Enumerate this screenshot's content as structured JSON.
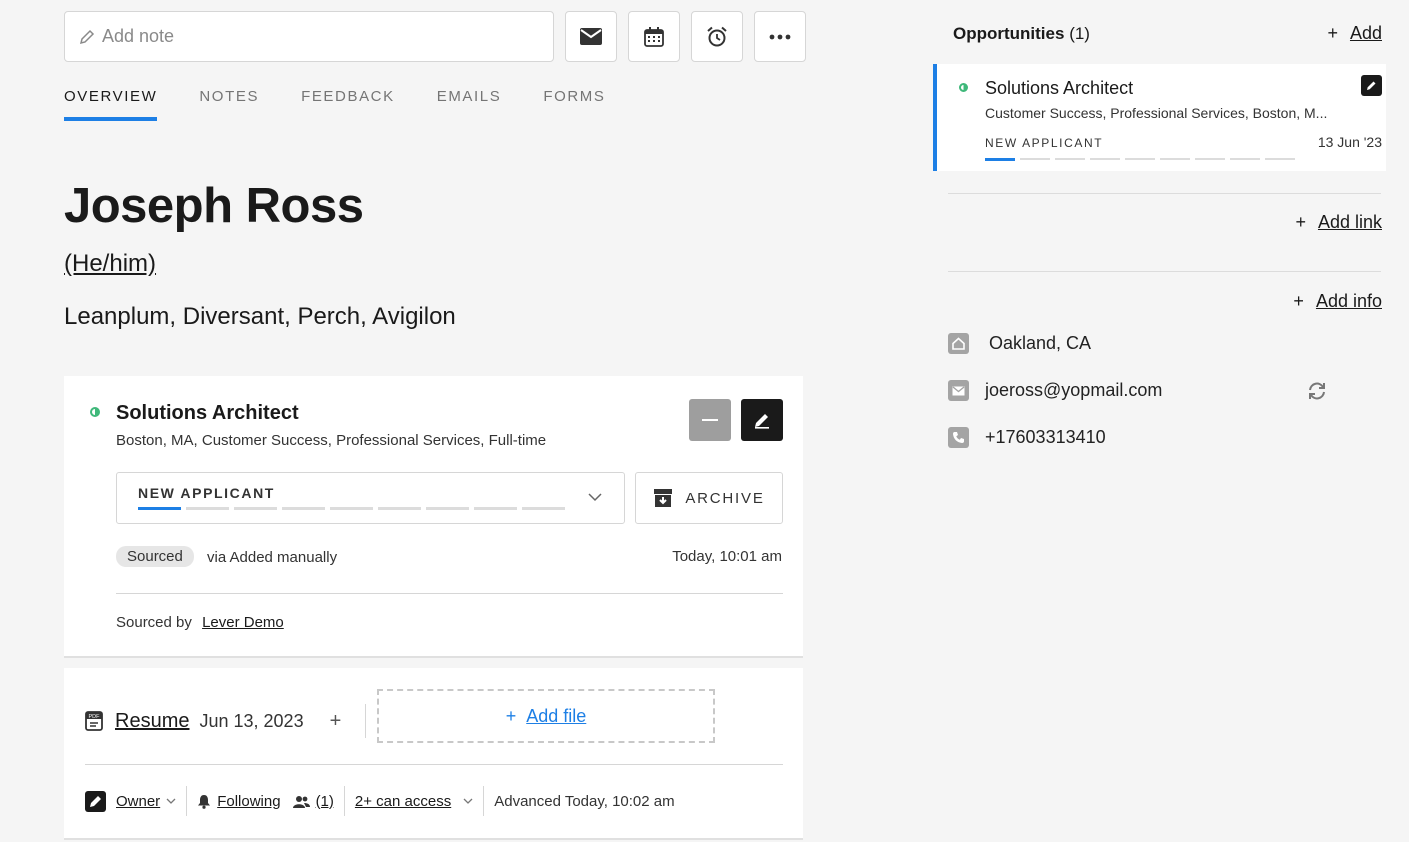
{
  "note": {
    "placeholder": "Add note"
  },
  "tabs": [
    {
      "label": "OVERVIEW",
      "active": true
    },
    {
      "label": "NOTES"
    },
    {
      "label": "FEEDBACK"
    },
    {
      "label": "EMAILS"
    },
    {
      "label": "FORMS"
    }
  ],
  "candidate": {
    "name": "Joseph Ross",
    "pronouns": "(He/him)",
    "companies": "Leanplum, Diversant, Perch, Avigilon"
  },
  "opportunity": {
    "title": "Solutions Architect",
    "subtitle": "Boston, MA, Customer Success, Professional Services, Full-time",
    "stage": "NEW APPLICANT",
    "stage_progress": "1 of 9",
    "archive_label": "ARCHIVE",
    "source_badge": "Sourced",
    "via": "via Added manually",
    "timestamp": "Today, 10:01 am",
    "sourced_by_label": "Sourced by",
    "sourced_by_name": "Lever Demo"
  },
  "files": {
    "resume_label": "Resume",
    "resume_date": "Jun 13, 2023",
    "add_file_label": "Add file"
  },
  "meta": {
    "owner": "Owner",
    "following": "Following",
    "followers_count": "(1)",
    "access": "2+ can access",
    "advanced": "Advanced Today, 10:02 am"
  },
  "sidebar": {
    "opportunities_label": "Opportunities",
    "opportunities_count": "(1)",
    "add_label": "Add",
    "card": {
      "title": "Solutions Architect",
      "subtitle": "Customer Success, Professional Services, Boston, M...",
      "stage": "NEW APPLICANT",
      "date": "13 Jun '23"
    },
    "add_link_label": "Add link",
    "add_info_label": "Add info",
    "location": "Oakland, CA",
    "email": "joeross@yopmail.com",
    "phone": "+17603313410"
  },
  "colors": {
    "accent": "#1d7fe5",
    "status_green": "#3fb87a",
    "dark": "#1a1a1a"
  }
}
